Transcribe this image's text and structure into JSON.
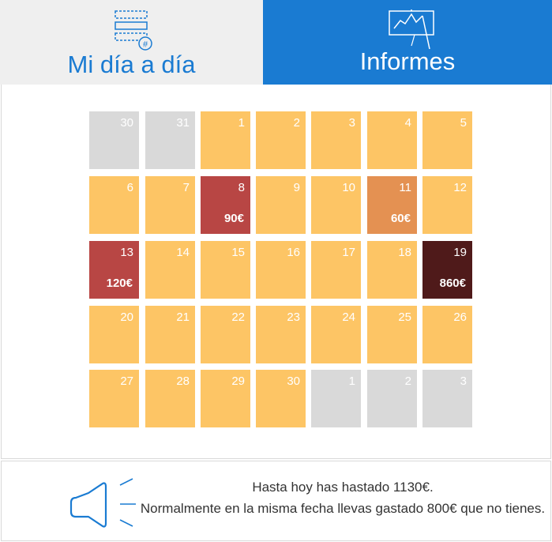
{
  "tabs": {
    "daily": {
      "label": "Mi día a día",
      "icon": "list-hash-icon"
    },
    "reports": {
      "label": "Informes",
      "icon": "chart-board-icon"
    }
  },
  "colors": {
    "normal": "#fdc565",
    "other_month": "#d9d9d9",
    "spend_low": "#e49152",
    "spend_mid": "#b84644",
    "spend_high": "#4f1a1a",
    "accent": "#1a7bd2"
  },
  "calendar": {
    "days": [
      {
        "day": "30",
        "kind": "other_month",
        "amount": ""
      },
      {
        "day": "31",
        "kind": "other_month",
        "amount": ""
      },
      {
        "day": "1",
        "kind": "normal",
        "amount": ""
      },
      {
        "day": "2",
        "kind": "normal",
        "amount": ""
      },
      {
        "day": "3",
        "kind": "normal",
        "amount": ""
      },
      {
        "day": "4",
        "kind": "normal",
        "amount": ""
      },
      {
        "day": "5",
        "kind": "normal",
        "amount": ""
      },
      {
        "day": "6",
        "kind": "normal",
        "amount": ""
      },
      {
        "day": "7",
        "kind": "normal",
        "amount": ""
      },
      {
        "day": "8",
        "kind": "spend_mid",
        "amount": "90€"
      },
      {
        "day": "9",
        "kind": "normal",
        "amount": ""
      },
      {
        "day": "10",
        "kind": "normal",
        "amount": ""
      },
      {
        "day": "11",
        "kind": "spend_low",
        "amount": "60€"
      },
      {
        "day": "12",
        "kind": "normal",
        "amount": ""
      },
      {
        "day": "13",
        "kind": "spend_mid",
        "amount": "120€"
      },
      {
        "day": "14",
        "kind": "normal",
        "amount": ""
      },
      {
        "day": "15",
        "kind": "normal",
        "amount": ""
      },
      {
        "day": "16",
        "kind": "normal",
        "amount": ""
      },
      {
        "day": "17",
        "kind": "normal",
        "amount": ""
      },
      {
        "day": "18",
        "kind": "normal",
        "amount": ""
      },
      {
        "day": "19",
        "kind": "spend_high",
        "amount": "860€"
      },
      {
        "day": "20",
        "kind": "normal",
        "amount": ""
      },
      {
        "day": "21",
        "kind": "normal",
        "amount": ""
      },
      {
        "day": "22",
        "kind": "normal",
        "amount": ""
      },
      {
        "day": "23",
        "kind": "normal",
        "amount": ""
      },
      {
        "day": "24",
        "kind": "normal",
        "amount": ""
      },
      {
        "day": "25",
        "kind": "normal",
        "amount": ""
      },
      {
        "day": "26",
        "kind": "normal",
        "amount": ""
      },
      {
        "day": "27",
        "kind": "normal",
        "amount": ""
      },
      {
        "day": "28",
        "kind": "normal",
        "amount": ""
      },
      {
        "day": "29",
        "kind": "normal",
        "amount": ""
      },
      {
        "day": "30",
        "kind": "normal",
        "amount": ""
      },
      {
        "day": "1",
        "kind": "other_month",
        "amount": ""
      },
      {
        "day": "2",
        "kind": "other_month",
        "amount": ""
      },
      {
        "day": "3",
        "kind": "other_month",
        "amount": ""
      }
    ]
  },
  "footer": {
    "icon": "megaphone-icon",
    "line1": "Hasta hoy has hastado 1130€.",
    "line2": "Normalmente en la misma fecha llevas gastado 800€ que no tienes."
  }
}
